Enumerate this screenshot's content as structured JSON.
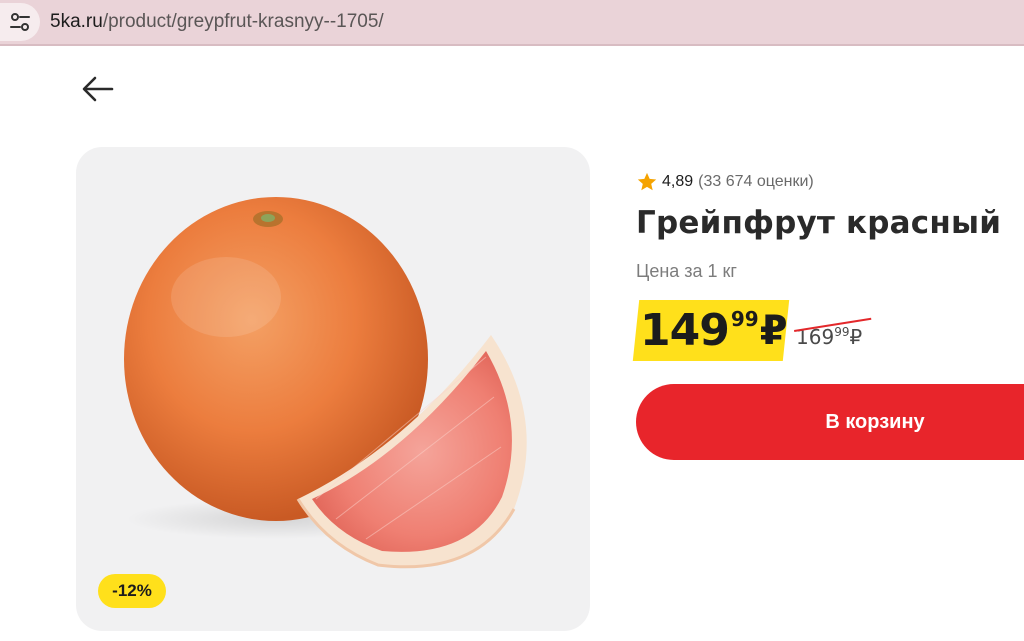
{
  "browser": {
    "url_domain": "5ka.ru",
    "url_path": "/product/greypfrut-krasnyy--1705/"
  },
  "product": {
    "rating": "4,89",
    "rating_count": "(33 674 оценки)",
    "title": "Грейпфрут красный",
    "price_unit": "Цена за 1 кг",
    "price": {
      "integer": "149",
      "kopecks": "99",
      "currency": "₽"
    },
    "old_price": {
      "integer": "169",
      "kopecks": "99",
      "currency": "₽"
    },
    "discount": "-12%",
    "add_to_cart_label": "В корзину"
  },
  "colors": {
    "accent_red": "#e8252b",
    "badge_yellow": "#ffe01b",
    "star": "#f5a300"
  },
  "icons": {
    "site_info": "tune-icon",
    "back": "arrow-left-icon",
    "rating": "star-icon"
  }
}
